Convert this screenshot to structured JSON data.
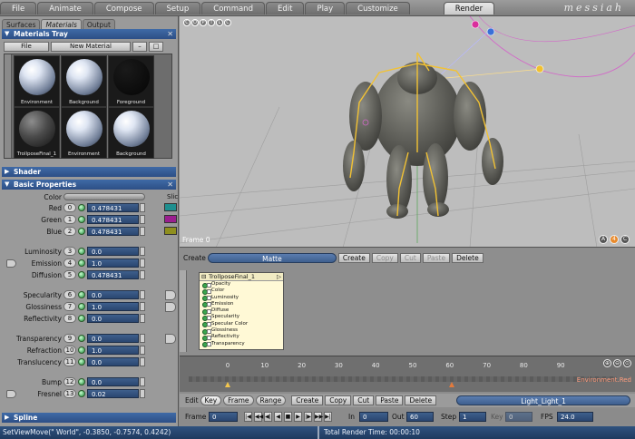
{
  "menu": {
    "tabs": [
      "File",
      "Animate",
      "Compose",
      "Setup",
      "Command",
      "Edit",
      "Play",
      "Customize",
      "Render"
    ],
    "active": "Render",
    "brand": "messiah"
  },
  "left_tabs": [
    "Surfaces",
    "Materials",
    "Output"
  ],
  "materials_tray": {
    "title": "Materials Tray",
    "file_label": "File",
    "new_material_label": "New Material",
    "thumbnails": [
      {
        "label": "Environment",
        "style": "white"
      },
      {
        "label": "Background",
        "style": "white"
      },
      {
        "label": "Foreground",
        "style": "black"
      },
      {
        "label": "TrollposeFinal_1",
        "style": "dark"
      },
      {
        "label": "Environment",
        "style": "white"
      },
      {
        "label": "Background",
        "style": "white"
      }
    ]
  },
  "shader_section": {
    "title": "Shader"
  },
  "basic_properties": {
    "title": "Basic Properties",
    "color_label": "Color",
    "slider_cut": "Slic",
    "rows": [
      {
        "label": "Red",
        "num": "0",
        "value": "0.478431",
        "swatch": "#1e8f8f"
      },
      {
        "label": "Green",
        "num": "1",
        "value": "0.478431",
        "swatch": "#9a1e8f"
      },
      {
        "label": "Blue",
        "num": "2",
        "value": "0.478431",
        "swatch": "#8f8f1e"
      },
      {
        "label": "Luminosity",
        "num": "3",
        "value": "0.0"
      },
      {
        "label": "Emission",
        "num": "4",
        "value": "1.0"
      },
      {
        "label": "Diffusion",
        "num": "5",
        "value": "0.478431"
      },
      {
        "label": "Specularity",
        "num": "6",
        "value": "0.0"
      },
      {
        "label": "Glossiness",
        "num": "7",
        "value": "1.0"
      },
      {
        "label": "Reflectivity",
        "num": "8",
        "value": "0.0"
      },
      {
        "label": "Transparency",
        "num": "9",
        "value": "0.0"
      },
      {
        "label": "Refraction",
        "num": "10",
        "value": "1.0"
      },
      {
        "label": "Translucency",
        "num": "11",
        "value": "0.0"
      },
      {
        "label": "Bump",
        "num": "12",
        "value": "0.0"
      },
      {
        "label": "Fresnel",
        "num": "13",
        "value": "0.02"
      }
    ]
  },
  "spline_section": {
    "title": "Spline"
  },
  "viewport": {
    "frame_label": "Frame 0",
    "corner_icons": [
      "C",
      "O",
      "P",
      "T",
      "L",
      "C"
    ],
    "br_icons": [
      "A",
      "4",
      "C"
    ]
  },
  "shader_editor": {
    "create_label": "Create",
    "matte_label": "Matte",
    "create_btn": "Create",
    "copy_btn": "Copy",
    "cut_btn": "Cut",
    "paste_btn": "Paste",
    "delete_btn": "Delete",
    "node": {
      "title": "TrollposeFinal_1",
      "items": [
        "Opacity",
        "Color",
        "Luminosity",
        "Emission",
        "Diffuse",
        "Specularity",
        "Specular Color",
        "Glossiness",
        "Reflectivity",
        "Transparency"
      ]
    }
  },
  "timeline": {
    "ticks": [
      "0",
      "10",
      "20",
      "30",
      "40",
      "50",
      "60",
      "70",
      "80",
      "90"
    ],
    "channel_label": "Environment.Red"
  },
  "edit_row": {
    "edit_label": "Edit",
    "key_btn": "Key",
    "frame_btn": "Frame",
    "range_btn": "Range",
    "create_btn": "Create",
    "copy_btn": "Copy",
    "cut_btn": "Cut",
    "paste_btn": "Paste",
    "delete_btn": "Delete",
    "light_label": "Light_Light_1"
  },
  "frame_row": {
    "frame_label": "Frame",
    "frame_value": "0",
    "in_label": "In",
    "in_value": "0",
    "out_label": "Out",
    "out_value": "60",
    "step_label": "Step",
    "step_value": "1",
    "key_label": "Key",
    "key_value": "0",
    "fps_label": "FPS",
    "fps_value": "24.0"
  },
  "status": {
    "left": "SetViewMove(\" World\", -0.3850, -0.7574, 0.4242)",
    "right": "Total Render Time: 00:00:10"
  }
}
